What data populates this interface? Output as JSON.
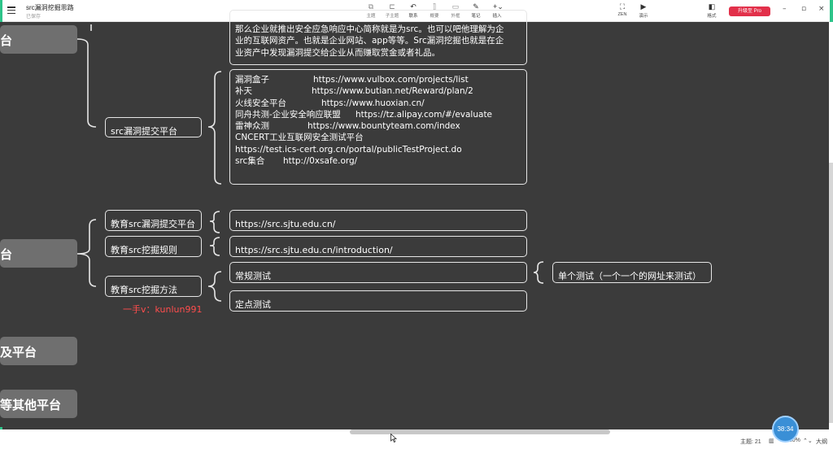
{
  "app": {
    "title": "src漏洞挖掘思路",
    "status": "已保存"
  },
  "toolbar": {
    "items": [
      {
        "label": "主题",
        "icon": "theme-icon"
      },
      {
        "label": "子主题",
        "icon": "subtopic-icon"
      },
      {
        "label": "联系",
        "icon": "relationship-icon"
      },
      {
        "label": "概要",
        "icon": "summary-icon"
      },
      {
        "label": "外框",
        "icon": "boundary-icon"
      },
      {
        "label": "笔记",
        "icon": "notes-icon"
      },
      {
        "label": "插入",
        "icon": "insert-icon"
      }
    ],
    "view": [
      {
        "label": "ZEN",
        "icon": "zen-icon"
      },
      {
        "label": "演示",
        "icon": "pitch-icon"
      }
    ],
    "format_label": "格式",
    "pro_label": "升级至 Pro"
  },
  "map": {
    "left_nodes": [
      "台",
      "台",
      "及平台",
      "等其他平台"
    ],
    "top_text": [
      "那么企业就推出安全应急响应中心简称就是为src。也可以吧他理解为企",
      "业的互联网资产。也就是企业网站、app等等。Src漏洞挖掘也就是在企",
      "业资产中发现漏洞提交给企业从而赚取赏金或者礼品。"
    ],
    "submit_platform_label": "src漏洞提交平台",
    "platform_lines": [
      {
        "name": "漏洞盒子",
        "url": "https://www.vulbox.com/projects/list"
      },
      {
        "name": "补天",
        "url": "https://www.butian.net/Reward/plan/2"
      },
      {
        "name": "火线安全平台",
        "url": "https://www.huoxian.cn/"
      },
      {
        "name": "同舟共测-企业安全响应联盟",
        "url": "https://tz.alipay.com/#/evaluate"
      },
      {
        "name": "雷神众测",
        "url": "https://www.bountyteam.com/index"
      },
      {
        "name": "CNCERT工业互联网安全测试平台",
        "url": ""
      },
      {
        "name": "https://test.ics-cert.org.cn/portal/publicTestProject.do",
        "url": ""
      },
      {
        "name": "src集合",
        "url": "http://0xsafe.org/"
      }
    ],
    "edu_submit_label": "教育src漏洞提交平台",
    "edu_submit_url": "https://src.sjtu.edu.cn/",
    "edu_rules_label": "教育src挖掘规则",
    "edu_rules_url": "https://src.sjtu.edu.cn/introduction/",
    "edu_method_label": "教育src挖掘方法",
    "method_regular": "常规测试",
    "method_single": "单个测试（一个一个的网址来测试）",
    "method_fixed": "定点测试",
    "watermark": "一手v：kunlun991"
  },
  "statusbar": {
    "topic_count": "主题: 21",
    "zoom": "130%",
    "outline_label": "大纲",
    "timer": "38:34"
  },
  "colors": {
    "canvas": "#3b3b3b",
    "pro": "#e2304a",
    "accent_green": "#2ec48a",
    "watermark": "#ff4d4d"
  }
}
